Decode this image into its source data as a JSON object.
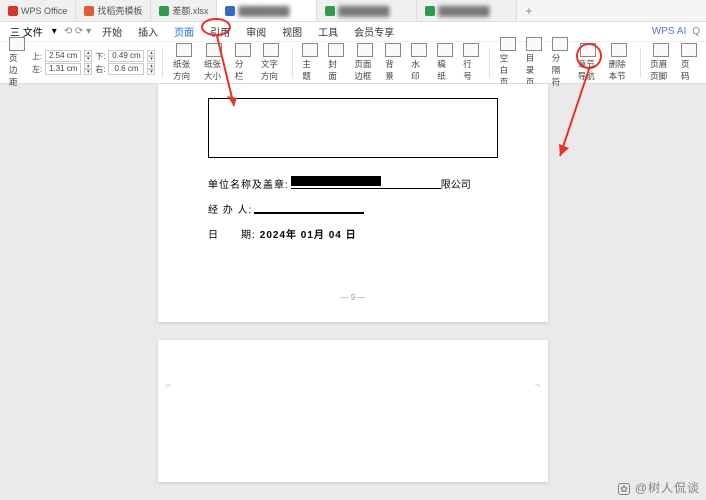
{
  "tabs": {
    "t0": "WPS Office",
    "t1": "找稻壳模板",
    "t2": "差额.xlsx",
    "t3": "",
    "t4": "",
    "t5": ""
  },
  "menu": {
    "app": "三 文件",
    "items": [
      "开始",
      "插入",
      "页面",
      "引用",
      "审阅",
      "视图",
      "工具",
      "会员专享"
    ],
    "ai": "WPS AI"
  },
  "ribbon": {
    "margin_btn": "页边距",
    "top_lbl": "上:",
    "top_val": "2.54",
    "bottom_lbl": "下:",
    "bottom_val": "0.49",
    "left_lbl": "左:",
    "left_val": "1.31",
    "right_lbl": "右:",
    "right_val": "0.6",
    "unit": "cm",
    "orient": "纸张方向",
    "size": "纸张大小",
    "cols": "分栏",
    "textdir": "文字方向",
    "theme": "主题",
    "cover": "封面",
    "border": "页面边框",
    "bg": "背景",
    "watermark": "水印",
    "paper": "稿纸",
    "lineno": "行号",
    "blank": "空白页",
    "toc": "目录页",
    "break": "分隔符",
    "chapter": "章节导航",
    "delete_section": "删除本节",
    "header_footer": "页眉页脚",
    "pagenum": "页码"
  },
  "doc": {
    "company_lbl": "单位名称及盖章:",
    "company_suffix": "限公司",
    "handler_lbl": "经 办 人: ",
    "date_lbl": "日　　期:",
    "date_val": "2024年 01月 04 日",
    "page_num": "— 9 —"
  },
  "watermark": "@树人侃谈"
}
